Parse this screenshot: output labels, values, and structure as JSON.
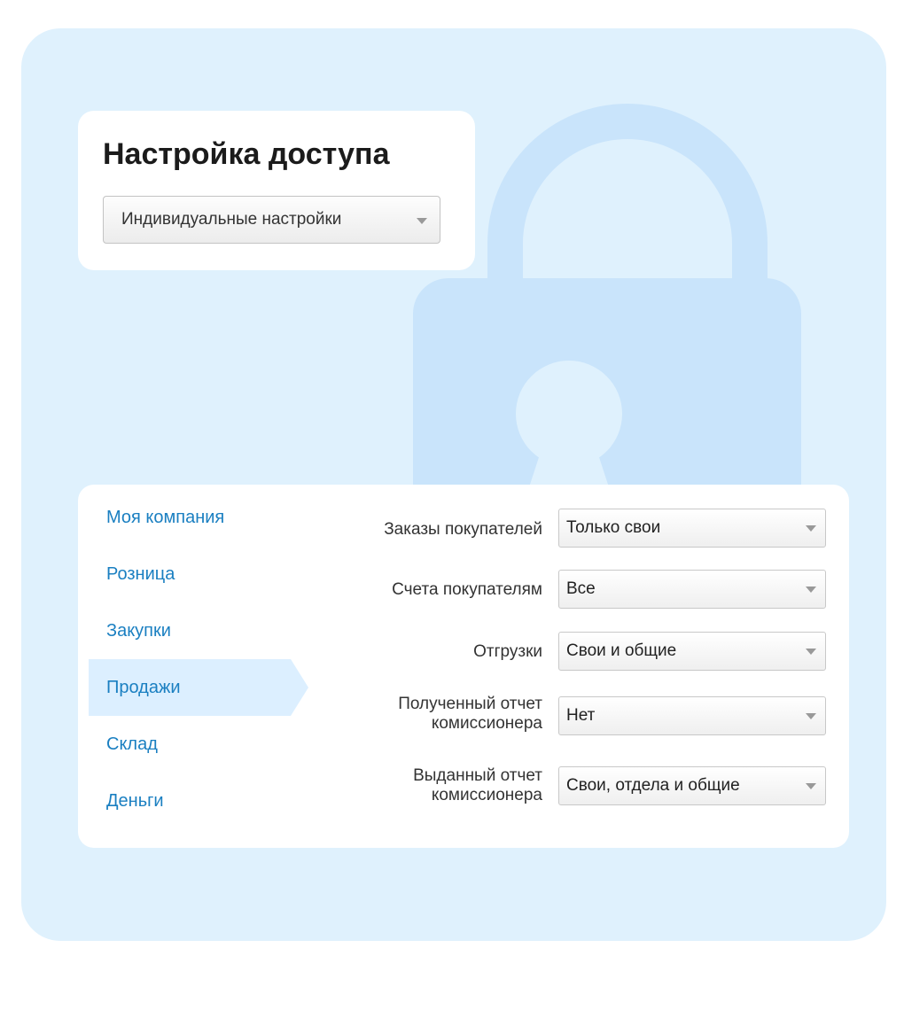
{
  "access": {
    "title": "Настройка доступа",
    "preset": "Индивидуальные настройки"
  },
  "nav": {
    "items": [
      {
        "label": "Моя компания",
        "active": false
      },
      {
        "label": "Розница",
        "active": false
      },
      {
        "label": "Закупки",
        "active": false
      },
      {
        "label": "Продажи",
        "active": true
      },
      {
        "label": "Склад",
        "active": false
      },
      {
        "label": "Деньги",
        "active": false
      }
    ]
  },
  "permissions": [
    {
      "label": "Заказы покупателей",
      "value": "Только свои"
    },
    {
      "label": "Счета покупателям",
      "value": "Все"
    },
    {
      "label": "Отгрузки",
      "value": "Свои и общие"
    },
    {
      "label": "Полученный отчет комиссионера",
      "value": "Нет"
    },
    {
      "label": "Выданный отчет комиссионера",
      "value": "Свои, отдела и общие"
    }
  ],
  "icons": {
    "background": "padlock-icon",
    "dropdown": "chevron-down-icon"
  },
  "colors": {
    "panel_bg": "#dff1fd",
    "lock": "#c9e4fb",
    "nav_link": "#1a7fc1",
    "nav_active_bg": "#dcefff"
  }
}
